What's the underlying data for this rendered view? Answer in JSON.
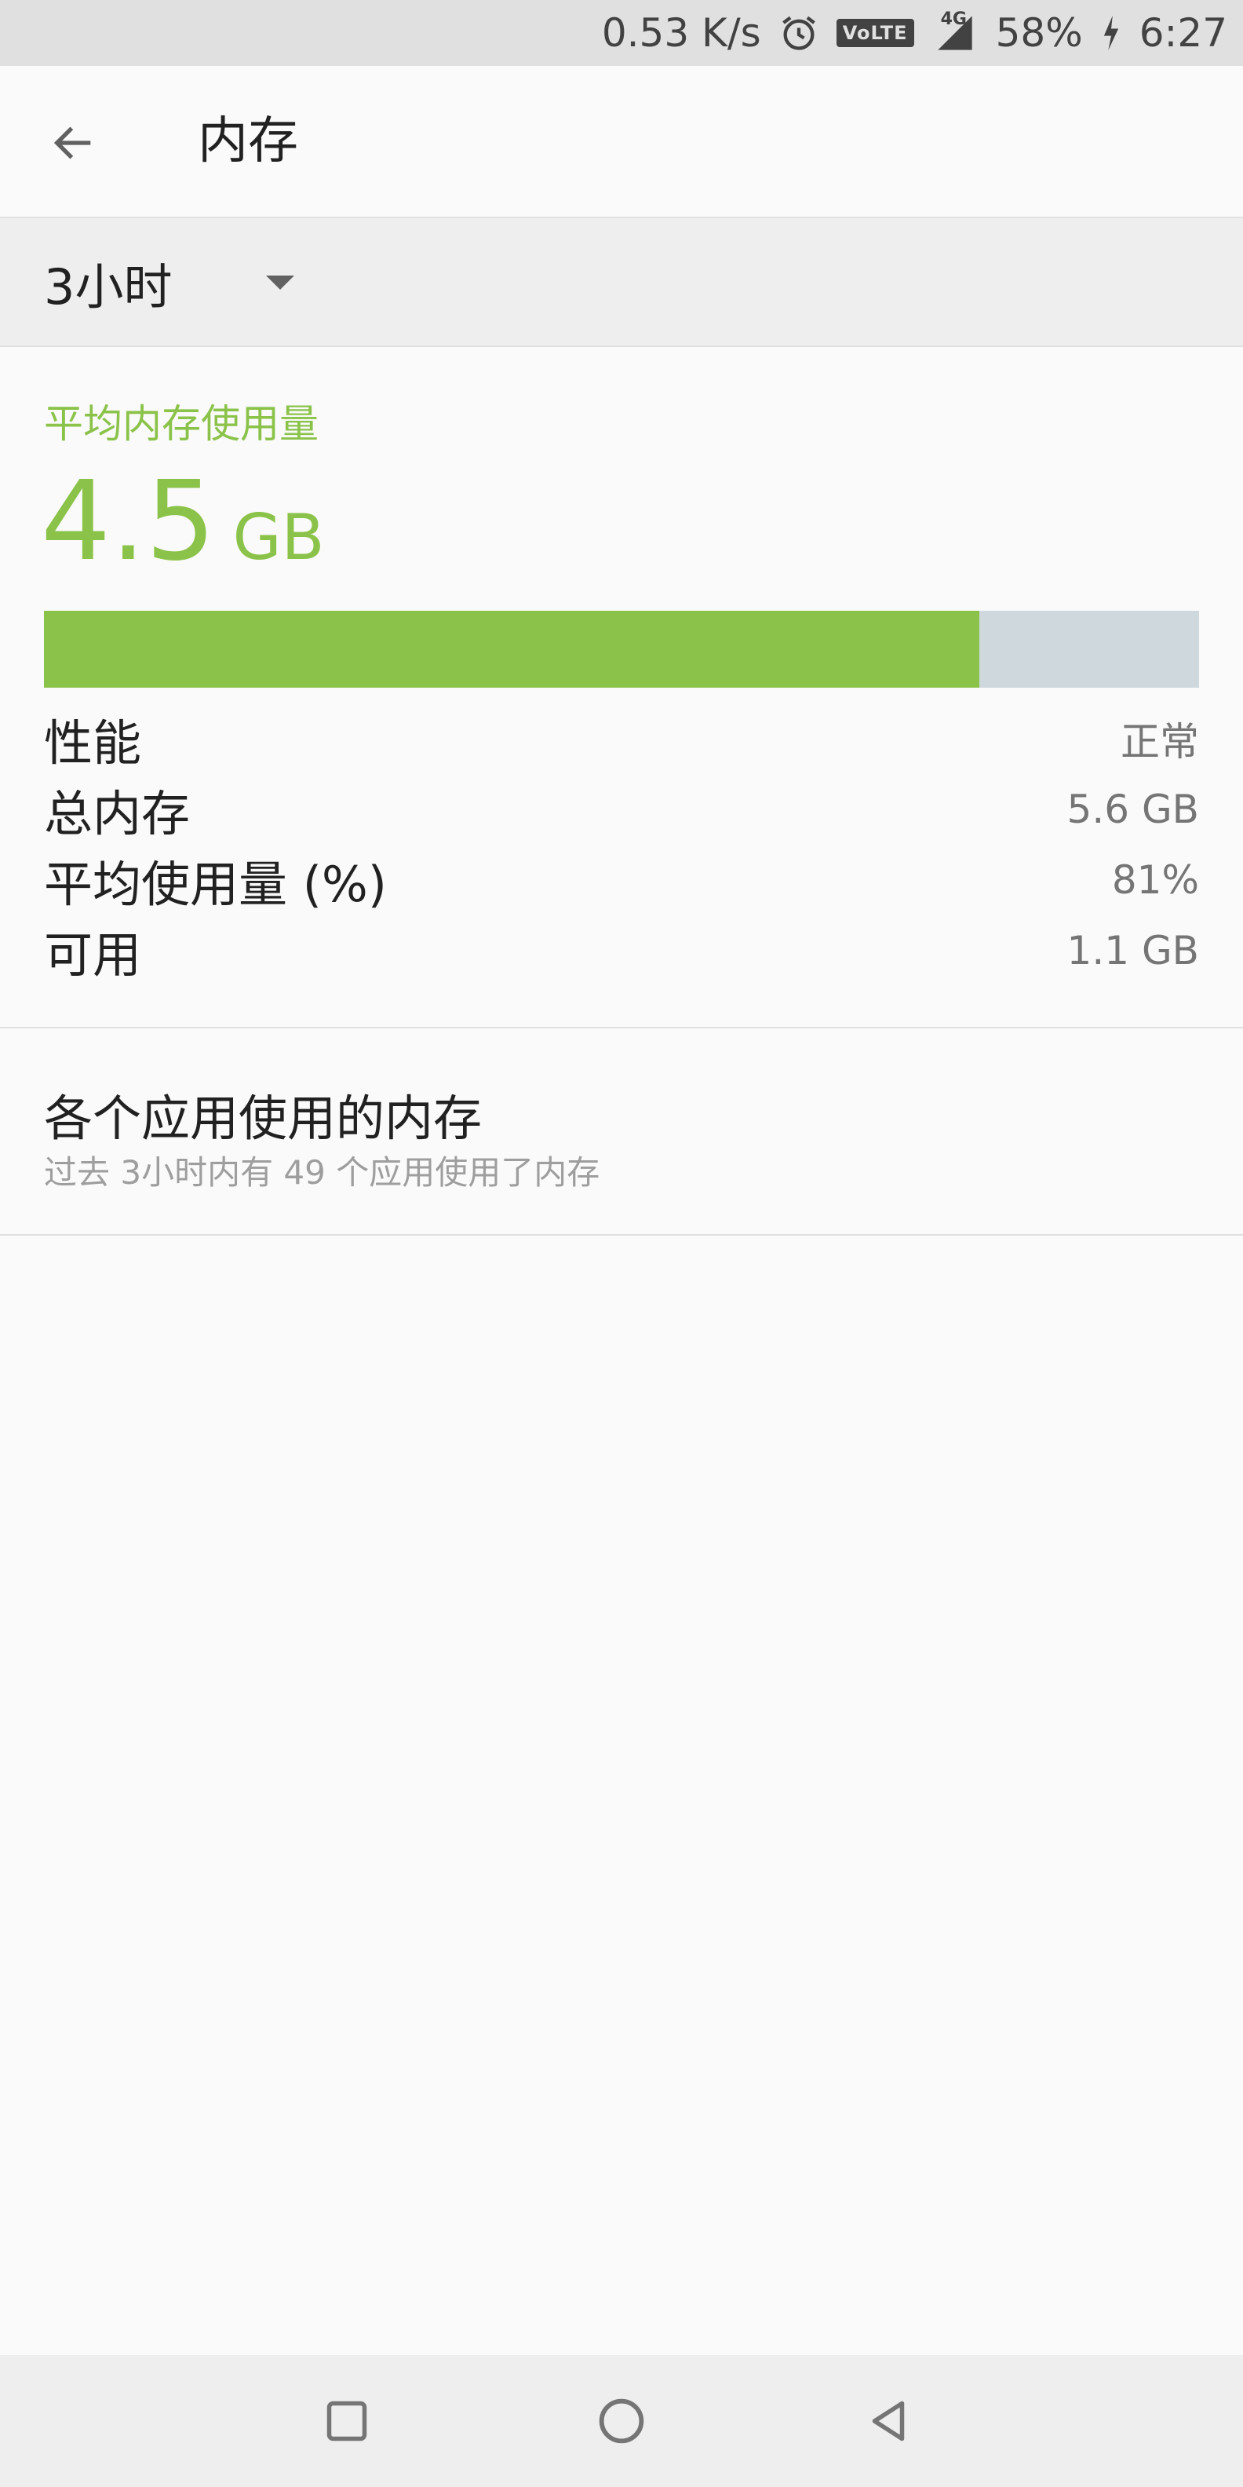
{
  "status_bar": {
    "net_speed": "0.53 K/s",
    "volte_label": "VoLTE",
    "network_label": "4G",
    "battery": "58%",
    "time": "6:27",
    "alarm_icon": "alarm-icon",
    "signal_icon": "signal-icon",
    "charging_icon": "charging-icon"
  },
  "app_bar": {
    "title": "内存",
    "back_icon": "arrow-back-icon"
  },
  "period": {
    "selected": "3小时"
  },
  "summary": {
    "heading": "平均内存使用量",
    "value": "4.5",
    "unit": "GB",
    "usage_fraction": 0.81
  },
  "stats": [
    {
      "label": "性能",
      "value": "正常"
    },
    {
      "label": "总内存",
      "value": "5.6 GB"
    },
    {
      "label": "平均使用量 (%)",
      "value": "81%"
    },
    {
      "label": "可用",
      "value": "1.1 GB"
    }
  ],
  "apps": {
    "title": "各个应用使用的内存",
    "subtitle": "过去 3小时内有 49 个应用使用了内存"
  },
  "nav_bar": {
    "recents_icon": "square-icon",
    "home_icon": "circle-icon",
    "back_icon": "triangle-back-icon"
  },
  "colors": {
    "accent": "#8bc34a",
    "bar_track": "#cfd8dc"
  }
}
